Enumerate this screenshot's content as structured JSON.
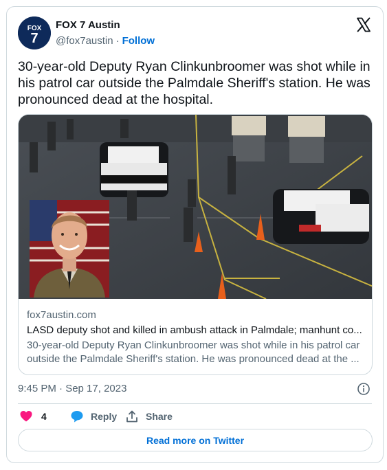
{
  "account": {
    "display_name": "FOX 7 Austin",
    "handle": "@fox7austin",
    "separator": "·",
    "follow_label": "Follow",
    "avatar_icon": "fox7-logo",
    "avatar_lines": [
      "FOX",
      "7"
    ],
    "avatar_color": "#0e2a5a"
  },
  "platform_icon": "x-logo",
  "tweet": {
    "text": "30-year-old Deputy Ryan Clinkunbroomer was shot while in his patrol car outside the Palmdale Sheriff's station. He was pronounced dead at the hospital."
  },
  "link_card": {
    "domain": "fox7austin.com",
    "headline": "LASD deputy shot and killed in ambush attack in Palmdale; manhunt co...",
    "description": "30-year-old Deputy Ryan Clinkunbroomer was shot while in his patrol car outside the Palmdale Sheriff's station. He was pronounced dead at the ..."
  },
  "meta": {
    "timestamp": "9:45 PM · Sep 17, 2023"
  },
  "actions": {
    "like_count": "4",
    "reply_label": "Reply",
    "share_label": "Share",
    "read_more_label": "Read more on Twitter"
  },
  "colors": {
    "link_blue": "#006fd6",
    "like_pink": "#f91880",
    "reply_blue": "#1d9bf0",
    "muted_text": "#536471",
    "border": "#cfd9de"
  }
}
